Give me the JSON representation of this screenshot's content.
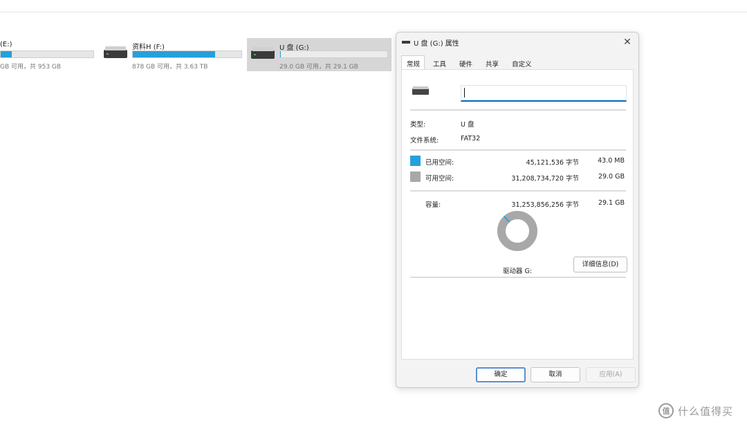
{
  "drives": [
    {
      "name": "(E:)",
      "info": "GB 可用，共 953 GB",
      "fill": 0.12
    },
    {
      "name": "资料H (F:)",
      "info": "878 GB 可用，共 3.63 TB",
      "fill": 0.76
    },
    {
      "name": "U 盘 (G:)",
      "info": "29.0 GB 可用，共 29.1 GB",
      "fill": 0.003
    }
  ],
  "dialog": {
    "title": "U 盘 (G:) 属性",
    "close": "✕",
    "tabs": [
      "常规",
      "工具",
      "硬件",
      "共享",
      "自定义"
    ],
    "name_value": "",
    "type_label": "类型:",
    "type_value": "U 盘",
    "fs_label": "文件系统:",
    "fs_value": "FAT32",
    "used_label": "已用空间:",
    "used_bytes": "45,121,536 字节",
    "used_size": "43.0 MB",
    "free_label": "可用空间:",
    "free_bytes": "31,208,734,720 字节",
    "free_size": "29.0 GB",
    "cap_label": "容量:",
    "cap_bytes": "31,253,856,256 字节",
    "cap_size": "29.1 GB",
    "drive_label": "驱动器 G:",
    "details_button": "详细信息(D)",
    "ok_button": "确定",
    "cancel_button": "取消",
    "apply_button": "应用(A)",
    "used_fraction": 0.0014
  },
  "colors": {
    "used": "#26a0da",
    "free": "#a8a8a8",
    "accent": "#0067c0"
  },
  "watermark": {
    "icon": "值",
    "text": "什么值得买"
  }
}
